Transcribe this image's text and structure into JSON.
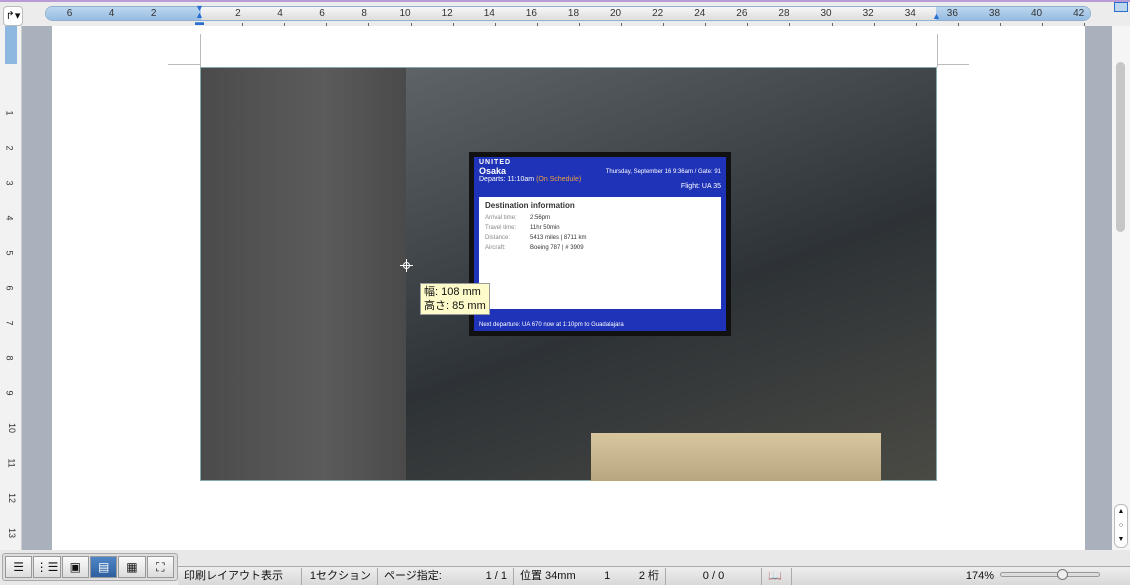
{
  "ruler": {
    "top_numbers_left": [
      "6",
      "4",
      "2"
    ],
    "top_numbers_right": [
      "2",
      "4",
      "6",
      "8",
      "10",
      "12",
      "14",
      "16",
      "18",
      "20",
      "22",
      "24",
      "26",
      "28",
      "30",
      "32",
      "34",
      "36",
      "38",
      "40",
      "42"
    ],
    "left_numbers": [
      "1",
      "2",
      "3",
      "4",
      "5",
      "6",
      "7",
      "8",
      "9",
      "10",
      "11",
      "12",
      "13"
    ]
  },
  "tooltip": {
    "width": "幅:  108 mm",
    "height": "高さ:  85 mm"
  },
  "sign": {
    "logo": "UNITED",
    "city": "Osaka",
    "departs": "Departs: 11:10am",
    "schedule": "(On Schedule)",
    "gate": "Thursday, September 16 9:36am / Gate: 91",
    "flight": "Flight: UA 35",
    "heading": "Destination information",
    "rows": [
      {
        "label": "Arrival time:",
        "value": "2:56pm"
      },
      {
        "label": "Travel time:",
        "value": "11hr 50min"
      },
      {
        "label": "Distance:",
        "value": "5413 miles | 8711 km"
      },
      {
        "label": "Aircraft:",
        "value": "Boeing 787 | # 3909"
      }
    ],
    "next": "Next departure: UA 670 now at 1:10pm to Guadalajara"
  },
  "views": [
    {
      "name": "outline-view",
      "icon": "☰"
    },
    {
      "name": "list-view",
      "icon": "⋮☰"
    },
    {
      "name": "draft-view",
      "icon": "▣"
    },
    {
      "name": "print-layout-view",
      "icon": "▤"
    },
    {
      "name": "notebook-view",
      "icon": "▦"
    },
    {
      "name": "fullscreen-view",
      "icon": "⛶"
    }
  ],
  "status": {
    "view_mode": "印刷レイアウト表示",
    "section": "1セクション",
    "page_label": "ページ指定:",
    "page": "1 / 1",
    "position": "位置 34mm",
    "line": "1",
    "column": "2 桁",
    "count": "0 / 0",
    "zoom": "174%"
  }
}
